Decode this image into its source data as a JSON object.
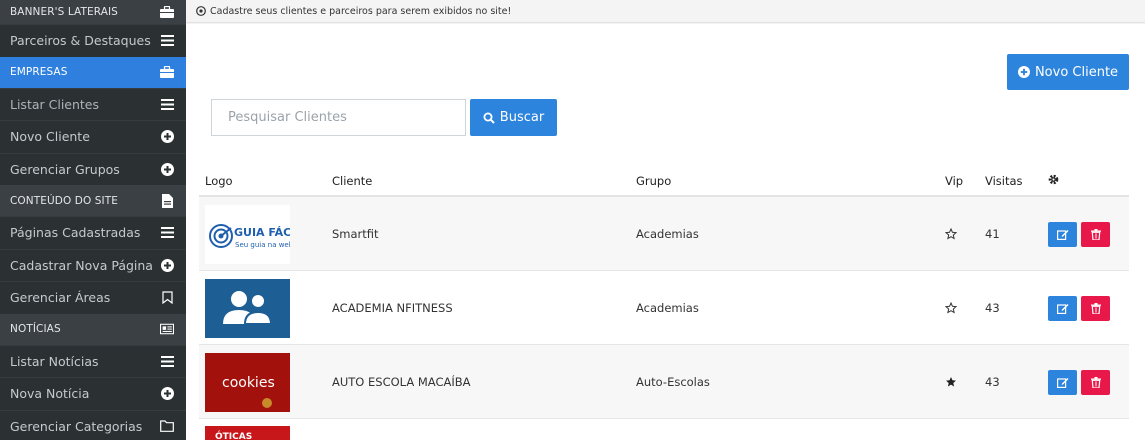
{
  "sidebar": {
    "sections": [
      {
        "type": "header",
        "label": "BANNER'S LATERAIS",
        "icon": "briefcase-icon"
      },
      {
        "type": "item",
        "label": "Parceiros & Destaques",
        "icon": "menu-icon"
      },
      {
        "type": "header",
        "label": "EMPRESAS",
        "icon": "briefcase-icon",
        "active": true
      },
      {
        "type": "item",
        "label": "Listar Clientes",
        "icon": "menu-icon"
      },
      {
        "type": "item",
        "label": "Novo Cliente",
        "icon": "plus-circle-icon"
      },
      {
        "type": "item",
        "label": "Gerenciar Grupos",
        "icon": "plus-circle-icon"
      },
      {
        "type": "header",
        "label": "CONTEÚDO DO SITE",
        "icon": "file-icon"
      },
      {
        "type": "item",
        "label": "Páginas Cadastradas",
        "icon": "menu-icon"
      },
      {
        "type": "item",
        "label": "Cadastrar Nova Página",
        "icon": "plus-circle-icon"
      },
      {
        "type": "item",
        "label": "Gerenciar Áreas",
        "icon": "bookmark-icon"
      },
      {
        "type": "header",
        "label": "NOTÍCIAS",
        "icon": "newspaper-icon"
      },
      {
        "type": "item",
        "label": "Listar Notícias",
        "icon": "menu-icon"
      },
      {
        "type": "item",
        "label": "Nova Notícia",
        "icon": "plus-circle-icon"
      },
      {
        "type": "item",
        "label": "Gerenciar Categorias",
        "icon": "folder-icon"
      }
    ]
  },
  "infobar": {
    "text": "Cadastre seus clientes e parceiros para serem exibidos no site!",
    "icon": "info-circle-icon"
  },
  "toolbar": {
    "new_client_label": "Novo Cliente",
    "search_placeholder": "Pesquisar Clientes",
    "search_value": "",
    "search_button_label": "Buscar"
  },
  "table": {
    "headers": {
      "logo": "Logo",
      "cliente": "Cliente",
      "grupo": "Grupo",
      "vip": "Vip",
      "visitas": "Visitas",
      "actions_icon": "gear-icon"
    },
    "rows": [
      {
        "logo": "guia-facil-logo",
        "logo_text": "GUIA FÁCIL",
        "logo_subtext": "Seu guia na web",
        "cliente": "Smartfit",
        "grupo": "Academias",
        "vip": false,
        "visitas": "41"
      },
      {
        "logo": "people-logo",
        "cliente": "ACADEMIA NFITNESS",
        "grupo": "Academias",
        "vip": false,
        "visitas": "43"
      },
      {
        "logo": "cookies-logo",
        "logo_text": "cookies",
        "cliente": "AUTO ESCOLA MACAÍBA",
        "grupo": "Auto-Escolas",
        "vip": true,
        "visitas": "43"
      }
    ],
    "partial_row_logo": "oticas-logo",
    "partial_row_logo_text": "ÓTICAS"
  },
  "colors": {
    "accent": "#2d84dc",
    "danger": "#e8194a",
    "sidebar_bg": "#2b3033",
    "sidebar_header_bg": "#3a4044",
    "active": "#2f80de"
  }
}
